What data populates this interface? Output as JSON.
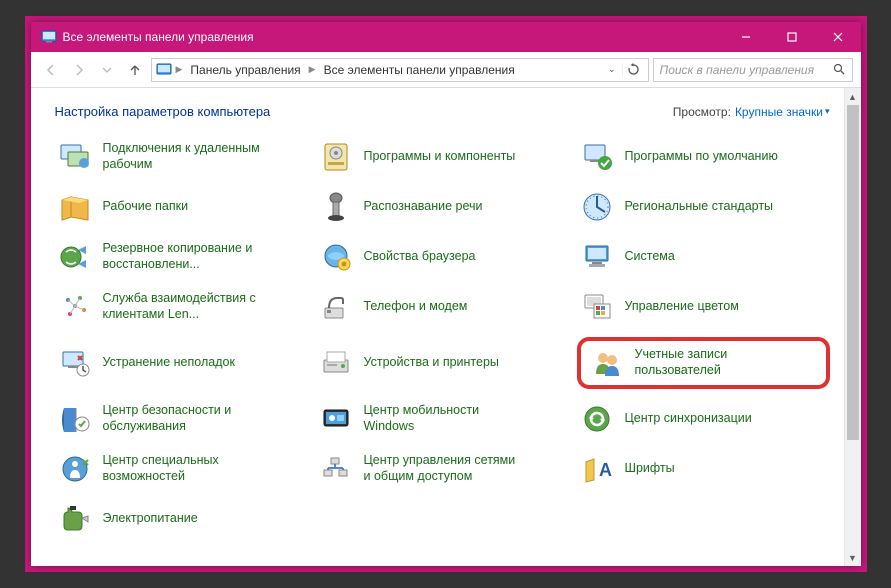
{
  "titlebar": {
    "title": "Все элементы панели управления"
  },
  "nav": {
    "crumb1": "Панель управления",
    "crumb2": "Все элементы панели управления",
    "search_placeholder": "Поиск в панели управления"
  },
  "header": {
    "title": "Настройка параметров компьютера",
    "viewby_label": "Просмотр:",
    "viewby_value": "Крупные значки"
  },
  "items": [
    {
      "label": "Подключения к удаленным рабочим"
    },
    {
      "label": "Программы и компоненты"
    },
    {
      "label": "Программы по умолчанию"
    },
    {
      "label": "Рабочие папки"
    },
    {
      "label": "Распознавание речи"
    },
    {
      "label": "Региональные стандарты"
    },
    {
      "label": "Резервное копирование и восстановлени..."
    },
    {
      "label": "Свойства браузера"
    },
    {
      "label": "Система"
    },
    {
      "label": "Служба взаимодействия с клиентами Len..."
    },
    {
      "label": "Телефон и модем"
    },
    {
      "label": "Управление цветом"
    },
    {
      "label": "Устранение неполадок"
    },
    {
      "label": "Устройства и принтеры"
    },
    {
      "label": "Учетные записи пользователей",
      "highlight": true
    },
    {
      "label": "Центр безопасности и обслуживания"
    },
    {
      "label": "Центр мобильности Windows"
    },
    {
      "label": "Центр синхронизации"
    },
    {
      "label": "Центр специальных возможностей"
    },
    {
      "label": "Центр управления сетями и общим доступом"
    },
    {
      "label": "Шрифты"
    },
    {
      "label": "Электропитание"
    }
  ]
}
